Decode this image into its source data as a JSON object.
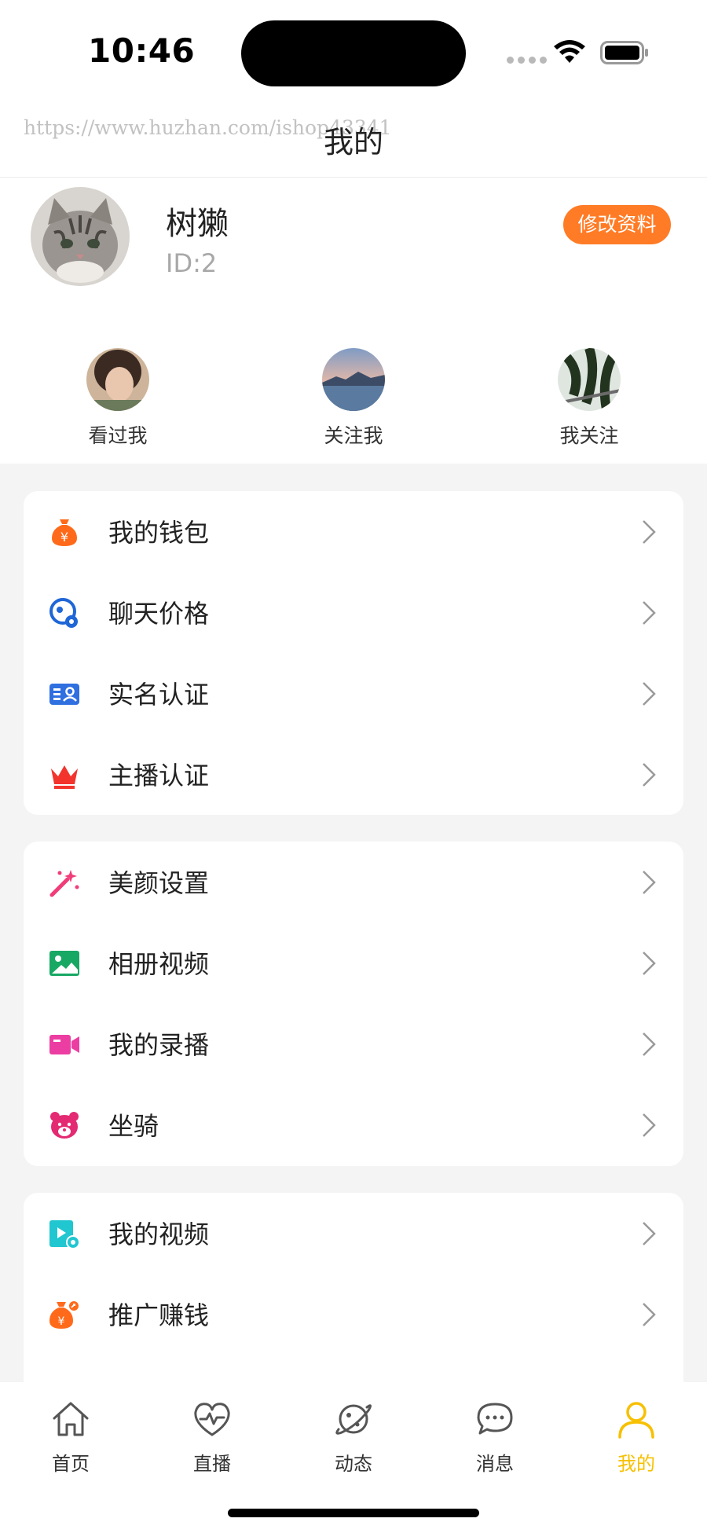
{
  "status_bar": {
    "time": "10:46"
  },
  "header": {
    "title": "我的",
    "watermark": "https://www.huzhan.com/ishop43341"
  },
  "profile": {
    "name": "树獭",
    "id": "ID:2",
    "edit_label": "修改资料"
  },
  "social": [
    {
      "label": "看过我"
    },
    {
      "label": "关注我"
    },
    {
      "label": "我关注"
    }
  ],
  "menu_groups": [
    {
      "items": [
        {
          "label": "我的钱包",
          "icon": "money-bag-icon"
        },
        {
          "label": "聊天价格",
          "icon": "chat-price-icon"
        },
        {
          "label": "实名认证",
          "icon": "id-card-icon"
        },
        {
          "label": "主播认证",
          "icon": "crown-icon"
        }
      ]
    },
    {
      "items": [
        {
          "label": "美颜设置",
          "icon": "magic-wand-icon"
        },
        {
          "label": "相册视频",
          "icon": "photo-album-icon"
        },
        {
          "label": "我的录播",
          "icon": "video-camera-icon"
        },
        {
          "label": "坐骑",
          "icon": "bear-icon"
        }
      ]
    },
    {
      "items": [
        {
          "label": "我的视频",
          "icon": "my-video-icon"
        },
        {
          "label": "推广赚钱",
          "icon": "promote-money-icon"
        }
      ]
    }
  ],
  "tabbar": {
    "items": [
      {
        "label": "首页",
        "icon": "home-icon"
      },
      {
        "label": "直播",
        "icon": "heart-pulse-icon"
      },
      {
        "label": "动态",
        "icon": "planet-icon"
      },
      {
        "label": "消息",
        "icon": "message-icon"
      },
      {
        "label": "我的",
        "icon": "user-icon",
        "active": true
      }
    ]
  },
  "colors": {
    "accent": "#ff7b25",
    "tab_active": "#f7c000",
    "background": "#f4f4f4"
  }
}
